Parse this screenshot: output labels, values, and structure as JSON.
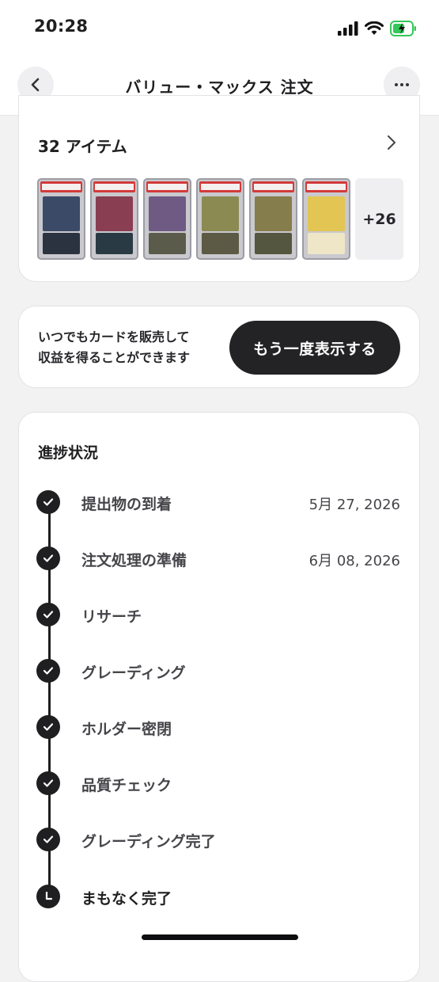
{
  "status_bar": {
    "time": "20:28"
  },
  "nav": {
    "title": "バリュー・マックス 注文"
  },
  "items": {
    "header": "32 アイテム",
    "thumbnails": [
      {
        "art": "#3b4a66",
        "body": "#2c3340"
      },
      {
        "art": "#8a3e52",
        "body": "#2a3a44"
      },
      {
        "art": "#6f5a84",
        "body": "#5b5b4c"
      },
      {
        "art": "#8b8a52",
        "body": "#5c5a45"
      },
      {
        "art": "#867d4c",
        "body": "#55563f"
      },
      {
        "art": "#e2c552",
        "body": "#efe6c8"
      }
    ],
    "more_label": "+26"
  },
  "sell": {
    "line1": "いつでもカードを販売して",
    "line2": "収益を得ることができます",
    "button_label": "もう一度表示する"
  },
  "progress": {
    "title": "進捗状況",
    "steps": [
      {
        "label": "提出物の到着",
        "date": "5月 27, 2026",
        "done": true
      },
      {
        "label": "注文処理の準備",
        "date": "6月 08, 2026",
        "done": true
      },
      {
        "label": "リサーチ",
        "date": "",
        "done": true
      },
      {
        "label": "グレーディング",
        "date": "",
        "done": true
      },
      {
        "label": "ホルダー密閉",
        "date": "",
        "done": true
      },
      {
        "label": "品質チェック",
        "date": "",
        "done": true
      },
      {
        "label": "グレーディング完了",
        "date": "",
        "done": true
      },
      {
        "label": "まもなく完了",
        "date": "",
        "done": false
      }
    ]
  },
  "colors": {
    "accent_dark": "#1f1f21",
    "battery_green": "#34c759",
    "background": "#f2f2f3"
  }
}
